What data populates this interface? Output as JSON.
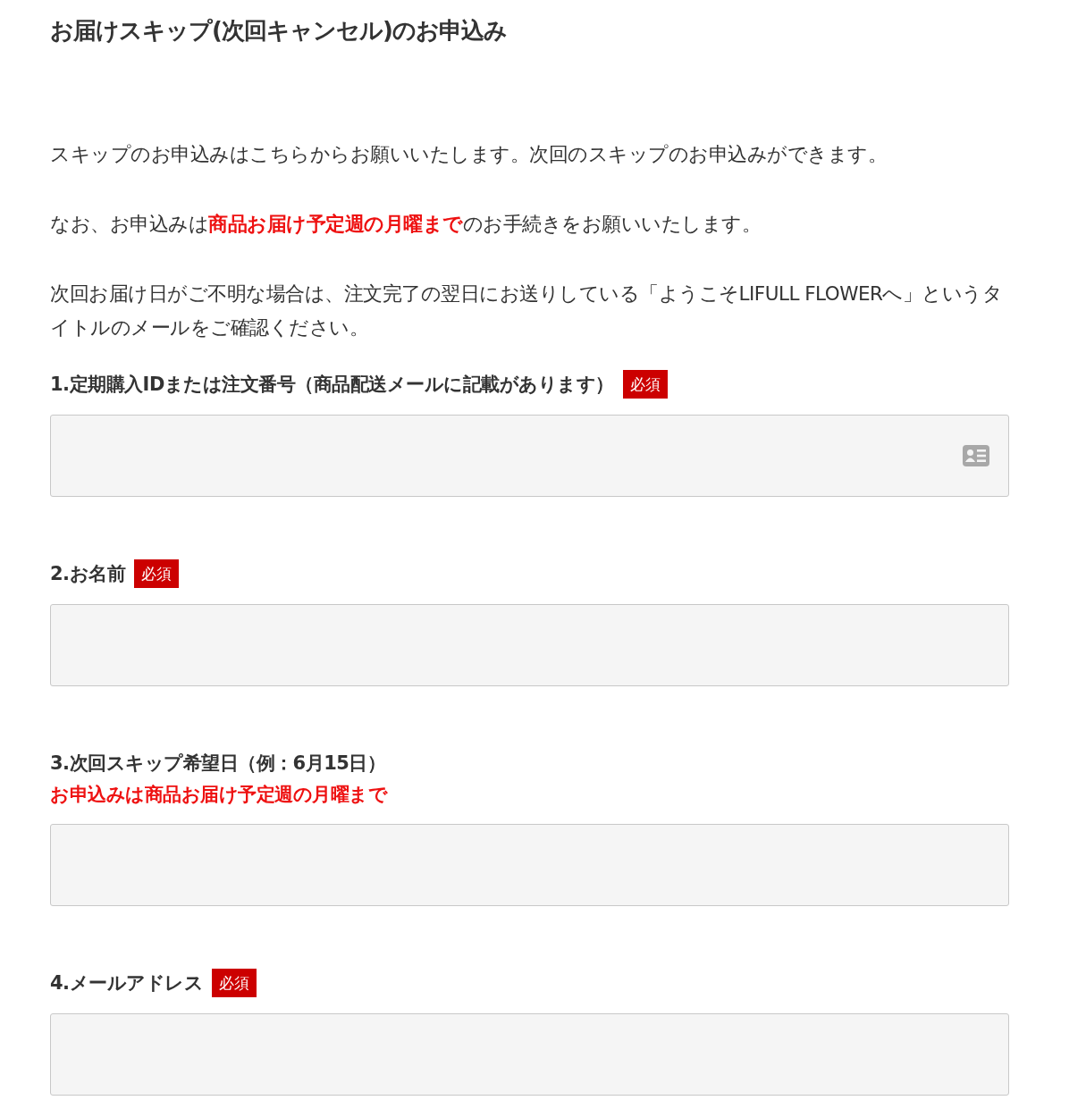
{
  "title": "お届けスキップ(次回キャンセル)のお申込み",
  "paragraphs": [
    [
      {
        "text": "スキップのお申込みはこちらからお願いいたします。次回のスキップのお申込みができます。",
        "highlight": false
      }
    ],
    [
      {
        "text": "なお、お申込みは",
        "highlight": false
      },
      {
        "text": "商品お届け予定週の月曜まで",
        "highlight": true
      },
      {
        "text": "のお手続きをお願いいたします。",
        "highlight": false
      }
    ],
    [
      {
        "text": "次回お届け日がご不明な場合は、注文完了の翌日にお送りしている「ようこそLIFULL FLOWERへ」というタイトルのメールをご確認ください。",
        "highlight": false
      }
    ]
  ],
  "fields": [
    {
      "label": "1.定期購入IDまたは注文番号（商品配送メールに記載があります）",
      "required": true,
      "required_label": "必須",
      "kind": "contact"
    },
    {
      "label": "2.お名前",
      "required": true,
      "required_label": "必須",
      "kind": "plain"
    },
    {
      "label": "3.次回スキップ希望日（例：6月15日）",
      "required": false,
      "note": "お申込みは商品お届け予定週の月曜まで",
      "kind": "plain"
    },
    {
      "label": "4.メールアドレス",
      "required": true,
      "required_label": "必須",
      "kind": "plain"
    }
  ]
}
